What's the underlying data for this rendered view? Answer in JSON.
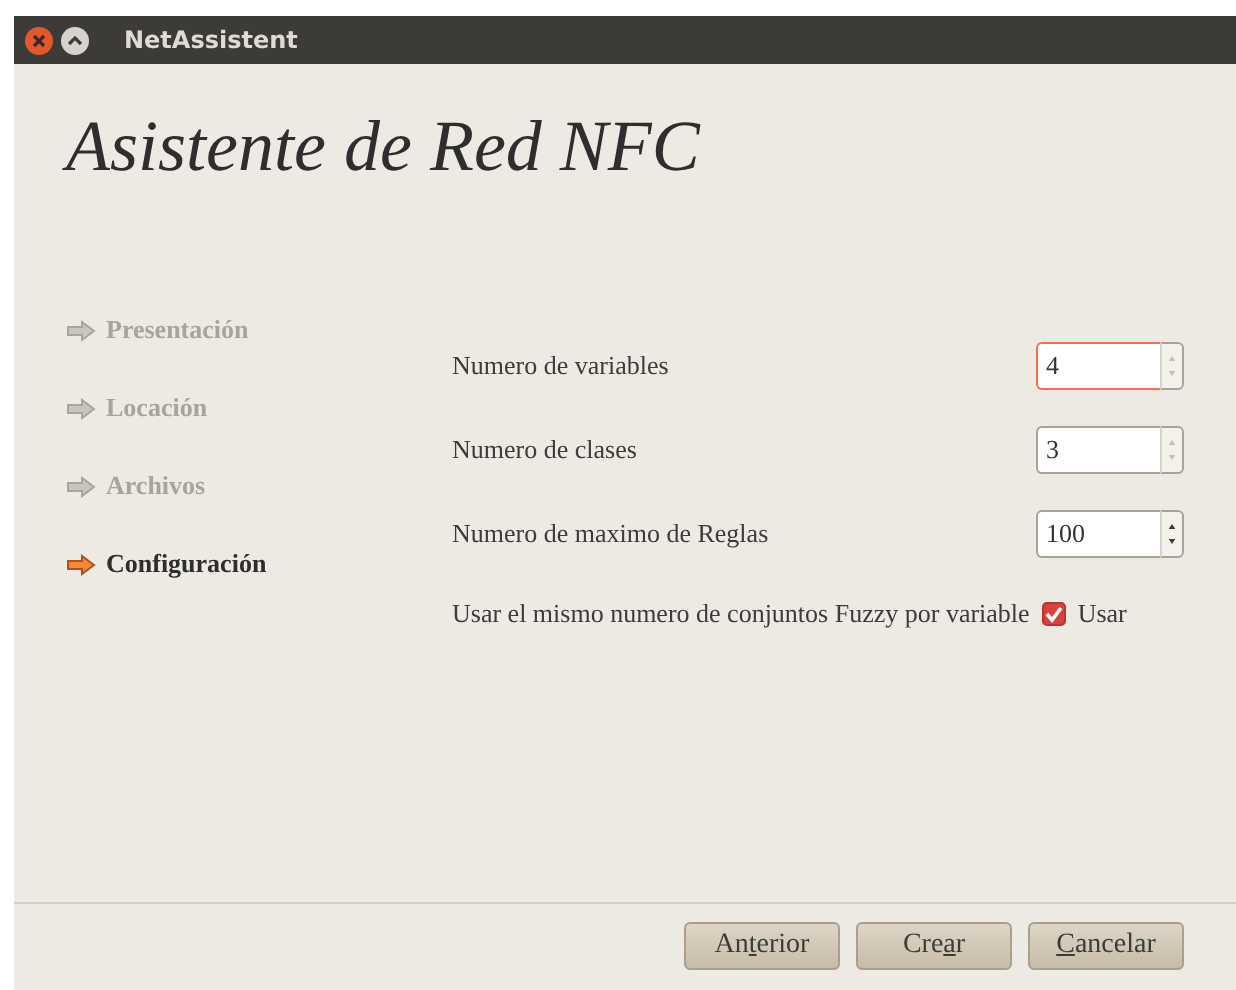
{
  "window": {
    "title": "NetAssistent"
  },
  "heading": "Asistente de Red NFC",
  "steps": [
    {
      "label": "Presentación",
      "selected": false
    },
    {
      "label": "Locación",
      "selected": false
    },
    {
      "label": "Archivos",
      "selected": false
    },
    {
      "label": "Configuración",
      "selected": true
    }
  ],
  "fields": [
    {
      "label": "Numero de variables",
      "value": "4",
      "focused": true,
      "spin_enabled": false
    },
    {
      "label": "Numero de clases",
      "value": "3",
      "focused": false,
      "spin_enabled": false
    },
    {
      "label": "Numero de maximo de Reglas",
      "value": "100",
      "focused": false,
      "spin_enabled": true
    }
  ],
  "option": {
    "label": "Usar el mismo numero de conjuntos Fuzzy por variable",
    "checkbox_label": "Usar",
    "checked": true
  },
  "buttons": [
    {
      "before": "An",
      "access_key": "t",
      "after": "erior"
    },
    {
      "before": "Cre",
      "access_key": "a",
      "after": "r"
    },
    {
      "access_key": "C",
      "after": "ancelar"
    }
  ]
}
